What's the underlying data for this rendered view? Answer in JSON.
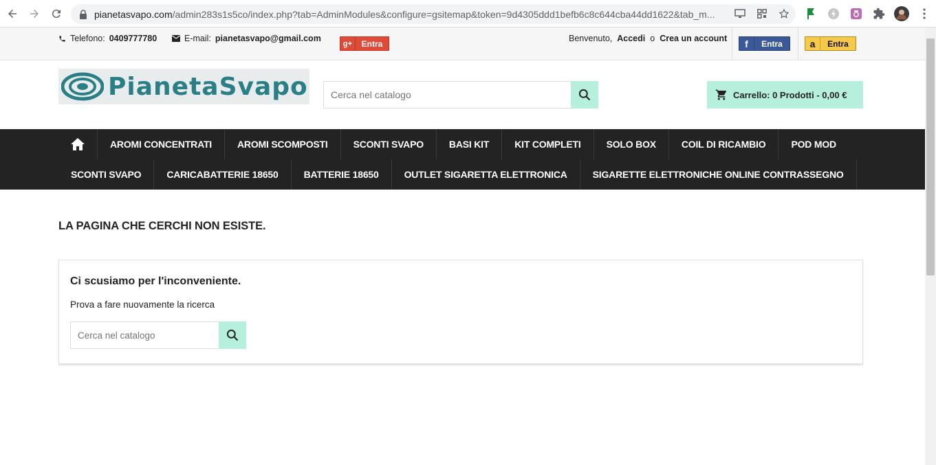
{
  "browser": {
    "url_host": "pianetasvapo.com",
    "url_rest": "/admin283s1s5co/index.php?tab=AdminModules&configure=gsitemap&token=9d4305ddd1befb6c8c644cba44dd1622&tab_m..."
  },
  "topbar": {
    "phone_label": "Telefono:",
    "phone_value": "0409777780",
    "email_label": "E-mail:",
    "email_value": "pianetasvapo@gmail.com",
    "gplus_label": "Entra",
    "welcome": "Benvenuto,",
    "login": "Accedi",
    "or": "o",
    "create_account": "Crea un account",
    "facebook_label": "Entra",
    "amazon_label": "Entra"
  },
  "header": {
    "logo_text": "PianetaSvapo",
    "search_placeholder": "Cerca nel catalogo",
    "cart_label": "Carrello: 0 Prodotti - 0,00 €"
  },
  "menu": {
    "row1": [
      "AROMI CONCENTRATI",
      "AROMI SCOMPOSTI",
      "SCONTI SVAPO",
      "BASI KIT",
      "KIT COMPLETI",
      "SOLO BOX",
      "COIL DI RICAMBIO",
      "POD MOD"
    ],
    "row2": [
      "SCONTI SVAPO",
      "CARICABATTERIE 18650",
      "BATTERIE 18650",
      "OUTLET SIGARETTA ELETTRONICA",
      "SIGARETTE ELETTRONICHE ONLINE CONTRASSEGNO"
    ]
  },
  "content": {
    "page_title": "LA PAGINA CHE CERCHI NON ESISTE.",
    "card_title": "Ci scusiamo per l'inconveniente.",
    "card_sub": "Prova a fare nuovamente la ricerca",
    "search_placeholder": "Cerca nel catalogo"
  },
  "colors": {
    "accent": "#b6f0dc",
    "menu_bg": "#232323",
    "gplus": "#dd4b39",
    "facebook": "#3b5998",
    "amazon": "#f7c948"
  }
}
